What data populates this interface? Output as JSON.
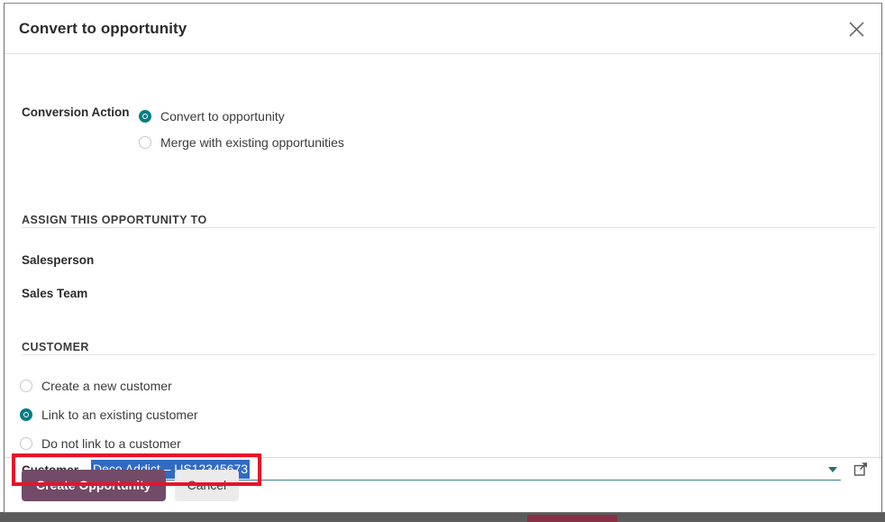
{
  "dialog": {
    "title": "Convert to opportunity",
    "close_icon": "close-icon"
  },
  "conversion": {
    "label": "Conversion Action",
    "options": [
      {
        "label": "Convert to opportunity",
        "selected": true
      },
      {
        "label": "Merge with existing opportunities",
        "selected": false
      }
    ]
  },
  "assign_section": {
    "title": "ASSIGN THIS OPPORTUNITY TO",
    "fields": [
      {
        "label": "Salesperson",
        "value": ""
      },
      {
        "label": "Sales Team",
        "value": ""
      }
    ]
  },
  "customer_section": {
    "title": "CUSTOMER",
    "options": [
      {
        "label": "Create a new customer",
        "selected": false
      },
      {
        "label": "Link to an existing customer",
        "selected": true
      },
      {
        "label": "Do not link to a customer",
        "selected": false
      }
    ],
    "customer_field": {
      "label": "Customer",
      "value": "Deco Addict – US12345673",
      "placeholder": "",
      "dropdown_icon": "chevron-down-icon",
      "external_link_icon": "external-link-icon",
      "selected_text": true
    }
  },
  "footer": {
    "primary_label": "Create Opportunity",
    "secondary_label": "Cancel"
  },
  "colors": {
    "accent_teal": "#017e84",
    "primary_button": "#714b67",
    "selection_blue": "#316ac5",
    "annotation_red": "#e8122b",
    "input_underline": "#3c7f85"
  }
}
